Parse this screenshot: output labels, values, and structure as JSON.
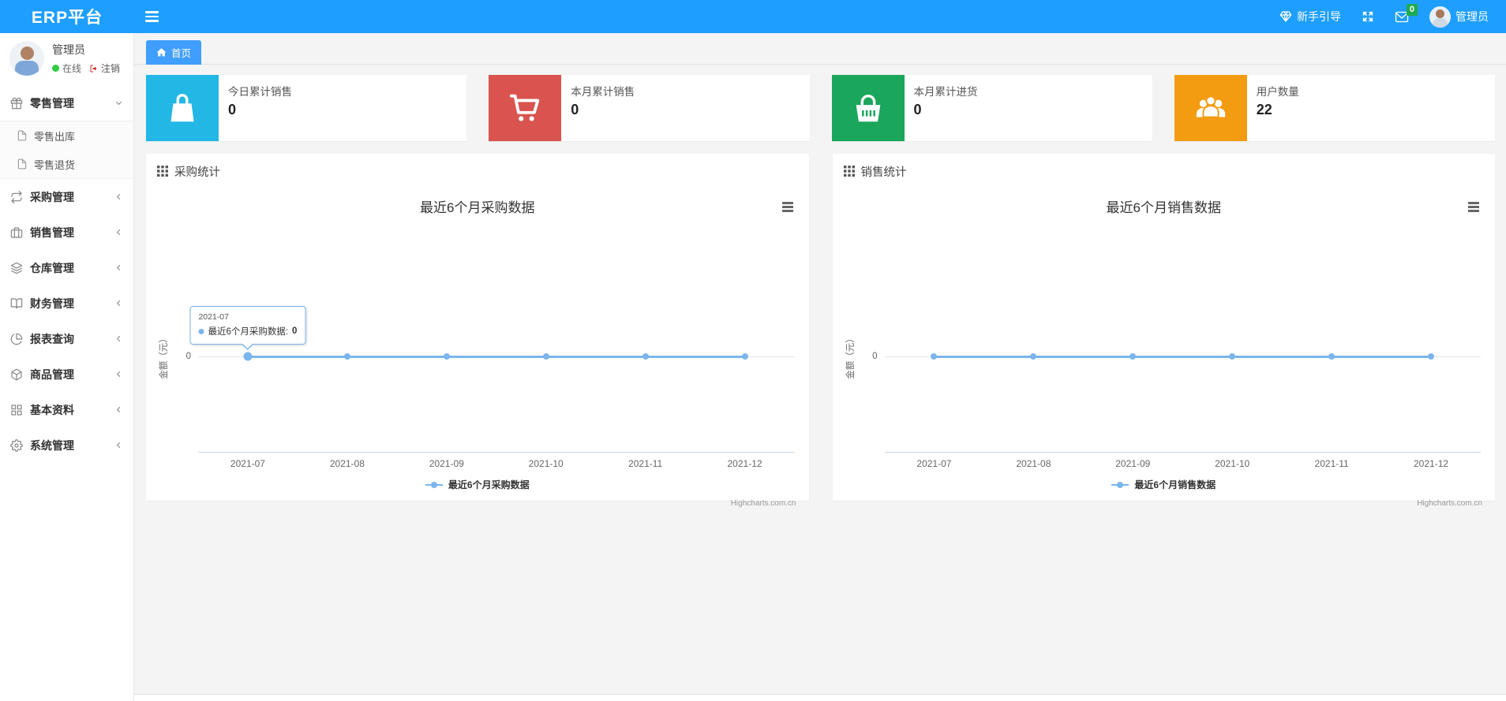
{
  "theme": {
    "navbar_color": "#1e9fff",
    "accent_blue": "#409eff",
    "chart_line_color": "#7cb5ec",
    "badge_color": "#1faa4d"
  },
  "navbar": {
    "brand": "ERP平台",
    "guide_label": "新手引导",
    "message_badge": "0",
    "username": "管理员"
  },
  "sidebar": {
    "user": {
      "name": "管理员",
      "status": "在线",
      "logout": "注销"
    },
    "menu": [
      {
        "label": "零售管理",
        "icon": "gift-icon",
        "state": "expanded",
        "children": [
          {
            "label": "零售出库",
            "icon": "file-icon"
          },
          {
            "label": "零售退货",
            "icon": "file-icon"
          }
        ]
      },
      {
        "label": "采购管理",
        "icon": "repeat-icon",
        "state": "collapsed"
      },
      {
        "label": "销售管理",
        "icon": "briefcase-icon",
        "state": "collapsed"
      },
      {
        "label": "仓库管理",
        "icon": "layers-icon",
        "state": "collapsed"
      },
      {
        "label": "财务管理",
        "icon": "book-icon",
        "state": "collapsed"
      },
      {
        "label": "报表查询",
        "icon": "pie-chart-icon",
        "state": "collapsed"
      },
      {
        "label": "商品管理",
        "icon": "box-icon",
        "state": "collapsed"
      },
      {
        "label": "基本资料",
        "icon": "grid-icon",
        "state": "collapsed"
      },
      {
        "label": "系统管理",
        "icon": "gear-icon",
        "state": "collapsed"
      }
    ]
  },
  "tabs": [
    {
      "label": "首页",
      "active": true
    }
  ],
  "stat_cards": [
    {
      "label": "今日累计销售",
      "value": "0",
      "icon": "shopping-bag-icon",
      "color": "#23b7e5",
      "icon_style": "background:#23b7e5"
    },
    {
      "label": "本月累计销售",
      "value": "0",
      "icon": "shopping-cart-icon",
      "color": "#d9534f",
      "icon_style": "background:#d9534f"
    },
    {
      "label": "本月累计进货",
      "value": "0",
      "icon": "shopping-basket-icon",
      "color": "#1aa65b",
      "icon_style": "background:#1aa65b"
    },
    {
      "label": "用户数量",
      "value": "22",
      "icon": "users-icon",
      "color": "#f39c12",
      "icon_style": "background:#f39c12"
    }
  ],
  "panels": [
    {
      "title": "采购统计"
    },
    {
      "title": "销售统计"
    }
  ],
  "chart_data": [
    {
      "type": "line",
      "title": "最近6个月采购数据",
      "categories": [
        "2021-07",
        "2021-08",
        "2021-09",
        "2021-10",
        "2021-11",
        "2021-12"
      ],
      "series": [
        {
          "name": "最近6个月采购数据",
          "values": [
            0,
            0,
            0,
            0,
            0,
            0
          ],
          "color": "#7cb5ec"
        }
      ],
      "xlabel": "",
      "ylabel": "金额（元）",
      "ytick": "0",
      "ylim": [
        0,
        1
      ],
      "grid": true,
      "legend_position": "bottom",
      "credits": "Highcharts.com.cn",
      "tooltip": {
        "visible": true,
        "header": "2021-07",
        "label": "最近6个月采购数据: ",
        "value": "0"
      }
    },
    {
      "type": "line",
      "title": "最近6个月销售数据",
      "categories": [
        "2021-07",
        "2021-08",
        "2021-09",
        "2021-10",
        "2021-11",
        "2021-12"
      ],
      "series": [
        {
          "name": "最近6个月销售数据",
          "values": [
            0,
            0,
            0,
            0,
            0,
            0
          ],
          "color": "#7cb5ec"
        }
      ],
      "xlabel": "",
      "ylabel": "金额（元）",
      "ytick": "0",
      "ylim": [
        0,
        1
      ],
      "grid": true,
      "legend_position": "bottom",
      "credits": "Highcharts.com.cn",
      "tooltip": {
        "visible": false
      }
    }
  ]
}
